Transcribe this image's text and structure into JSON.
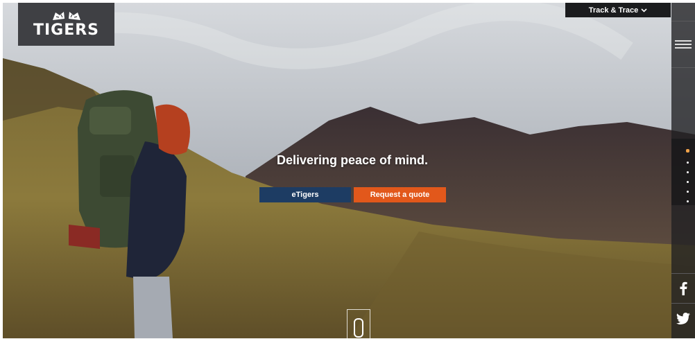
{
  "logo": {
    "text": "TIGERS",
    "icon": "tiger-heads-icon"
  },
  "header": {
    "track_label": "Track & Trace",
    "track_icon": "chevron-down-icon"
  },
  "hero": {
    "tagline": "Delivering peace of mind.",
    "buttons": {
      "etigers": "eTigers",
      "quote": "Request a quote"
    }
  },
  "sidebar": {
    "menu_icon": "hamburger-menu-icon",
    "slides": {
      "count": 6,
      "active_index": 0
    },
    "social": [
      "facebook-icon",
      "twitter-icon"
    ]
  },
  "colors": {
    "primary_button": "#1d3c63",
    "accent_button": "#e2581b",
    "active_dot": "#f0a24a"
  }
}
